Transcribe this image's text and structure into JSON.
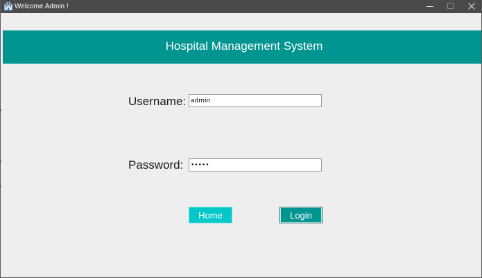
{
  "window": {
    "title": "Welcome Admin !",
    "icon": "hospital-app-icon",
    "controls": {
      "minimize_icon": "minimize-icon",
      "maximize_icon": "maximize-icon",
      "close_icon": "close-icon"
    }
  },
  "header": {
    "title": "Hospital Management System",
    "background_color": "#009591"
  },
  "form": {
    "username_label": "Username:",
    "username_value": "admin",
    "password_label": "Password:",
    "password_value": "admin"
  },
  "buttons": {
    "home_label": "Home",
    "login_label": "Login",
    "home_color": "#00C8C8",
    "login_color": "#009591"
  }
}
